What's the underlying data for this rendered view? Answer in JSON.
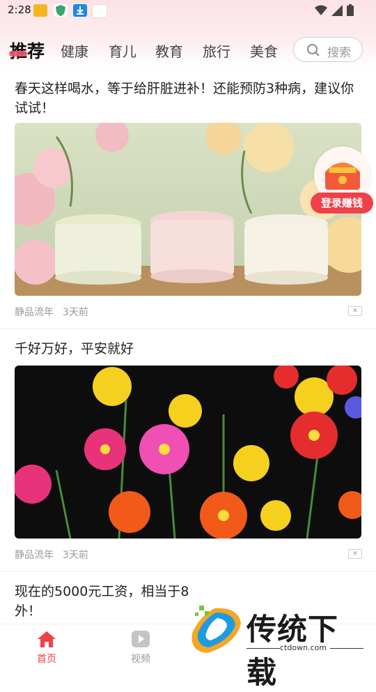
{
  "status_bar": {
    "time": "2:28"
  },
  "tabs": [
    {
      "label": "推荐",
      "active": true
    },
    {
      "label": "健康"
    },
    {
      "label": "育儿"
    },
    {
      "label": "教育"
    },
    {
      "label": "旅行"
    },
    {
      "label": "美食"
    }
  ],
  "search": {
    "placeholder": "搜索"
  },
  "articles": [
    {
      "title": "春天这样喝水，等于给肝脏进补！还能预防3种病，建议你试试！",
      "source": "静品流年",
      "time": "3天前"
    },
    {
      "title": "千好万好，平安就好",
      "source": "静品流年",
      "time": "3天前"
    },
    {
      "title_visible": "现在的5000元工资，相当于8",
      "title_line2": "外！"
    }
  ],
  "reward_float": {
    "label": "登录赚钱"
  },
  "bottom_nav": [
    {
      "label": "首页",
      "active": true,
      "icon": "home-icon"
    },
    {
      "label": "视频",
      "active": false,
      "icon": "play-icon"
    }
  ],
  "watermark": {
    "title": "传统下载",
    "url": "ctdown.com"
  },
  "colors": {
    "accent": "#f0526a",
    "red": "#f0404a",
    "tab_inactive": "#444444"
  }
}
